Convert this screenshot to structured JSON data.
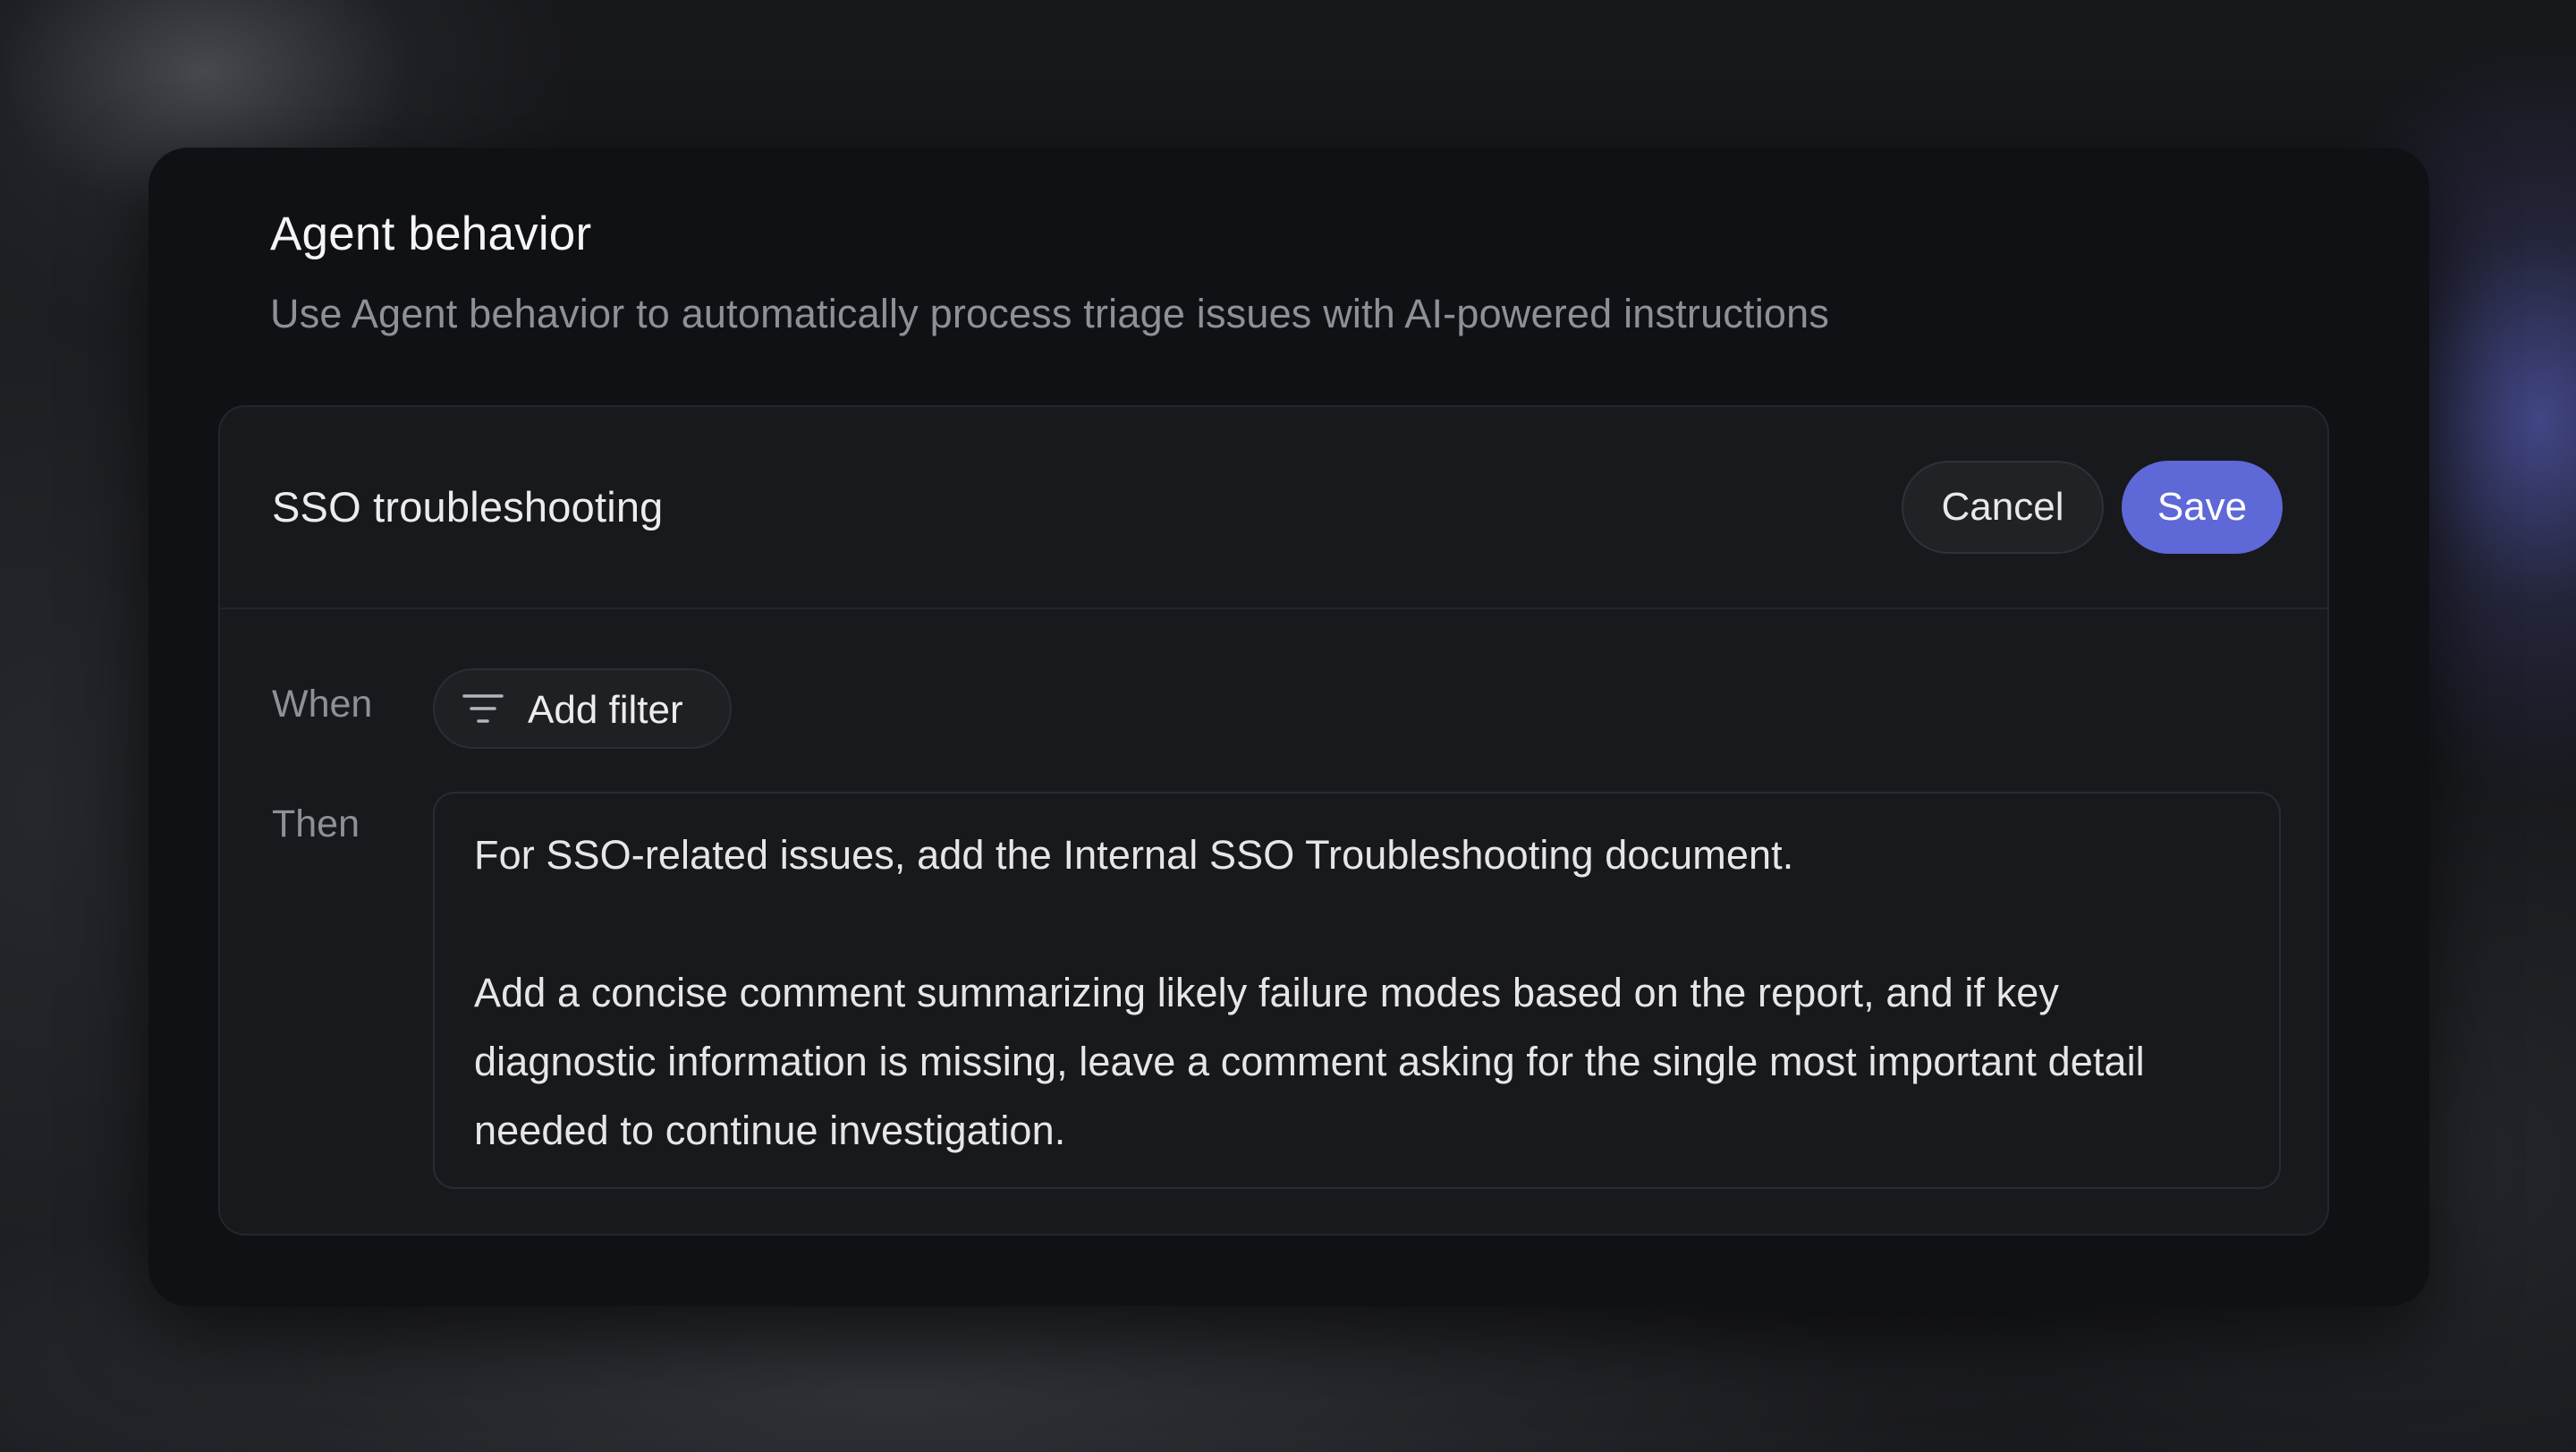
{
  "panel": {
    "title": "Agent behavior",
    "subtitle": "Use Agent behavior to automatically process triage issues with AI-powered instructions"
  },
  "rule": {
    "name": "SSO troubleshooting",
    "cancel_label": "Cancel",
    "save_label": "Save",
    "when_label": "When",
    "add_filter_label": "Add filter",
    "filter_icon": "filter-icon",
    "then_label": "Then",
    "instructions": "For SSO-related issues, add the Internal SSO Troubleshooting document.\n\nAdd a concise comment summarizing likely failure modes based on the report, and if key diagnostic information is missing, leave a comment asking for the single most important detail needed to continue investigation."
  },
  "colors": {
    "accent": "#5e68d6",
    "panel_bg": "#101114",
    "card_bg": "#18191d",
    "text_primary": "#ececef",
    "text_secondary": "#8e9097"
  }
}
